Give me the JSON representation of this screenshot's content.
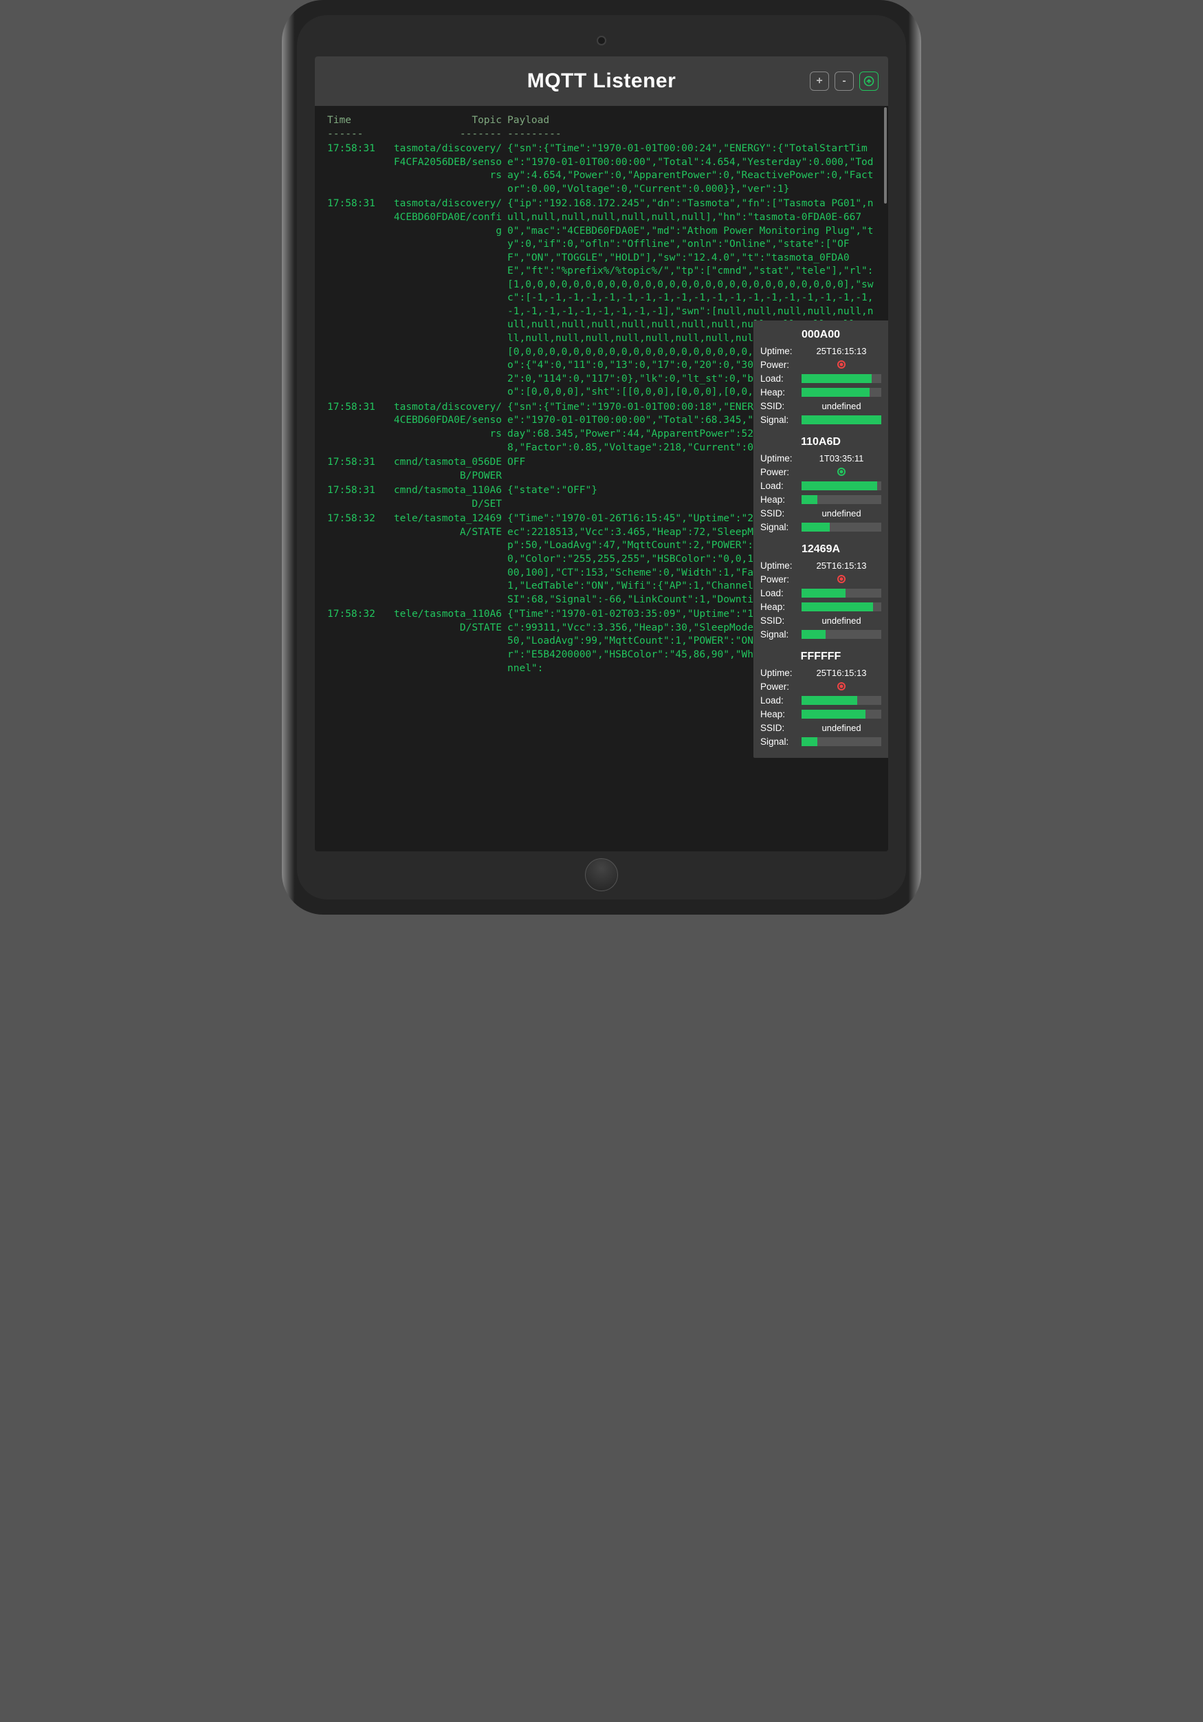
{
  "header": {
    "title": "MQTT Listener",
    "btn_plus": "+",
    "btn_minus": "-"
  },
  "columns": {
    "time": "Time",
    "topic": "Topic",
    "payload": "Payload"
  },
  "dashes": {
    "time": "------",
    "topic": "-------",
    "payload": "---------"
  },
  "rows": [
    {
      "time": "17:58:31",
      "topic": "tasmota/discovery/F4CFA2056DEB/sensors",
      "payload": "{\"sn\":{\"Time\":\"1970-01-01T00:00:24\",\"ENERGY\":{\"TotalStartTime\":\"1970-01-01T00:00:00\",\"Total\":4.654,\"Yesterday\":0.000,\"Today\":4.654,\"Power\":0,\"ApparentPower\":0,\"ReactivePower\":0,\"Factor\":0.00,\"Voltage\":0,\"Current\":0.000}},\"ver\":1}"
    },
    {
      "time": "17:58:31",
      "topic": "tasmota/discovery/4CEBD60FDA0E/config",
      "payload": "{\"ip\":\"192.168.172.245\",\"dn\":\"Tasmota\",\"fn\":[\"Tasmota PG01\",null,null,null,null,null,null,null],\"hn\":\"tasmota-0FDA0E-6670\",\"mac\":\"4CEBD60FDA0E\",\"md\":\"Athom Power Monitoring Plug\",\"ty\":0,\"if\":0,\"ofln\":\"Offline\",\"onln\":\"Online\",\"state\":[\"OFF\",\"ON\",\"TOGGLE\",\"HOLD\"],\"sw\":\"12.4.0\",\"t\":\"tasmota_0FDA0E\",\"ft\":\"%prefix%/%topic%/\",\"tp\":[\"cmnd\",\"stat\",\"tele\"],\"rl\":[1,0,0,0,0,0,0,0,0,0,0,0,0,0,0,0,0,0,0,0,0,0,0,0,0,0,0,0],\"swc\":[-1,-1,-1,-1,-1,-1,-1,-1,-1,-1,-1,-1,-1,-1,-1,-1,-1,-1,-1,-1,-1,-1,-1,-1,-1,-1,-1,-1],\"swn\":[null,null,null,null,null,null,null,null,null,null,null,null,null,null,null,null,null,null,null,null,null,null,null,null,null,null,null,null],\"btn\":[0,0,0,0,0,0,0,0,0,0,0,0,0,0,0,0,0,0,0,0,0,0,0,0,0,0,0,0],\"so\":{\"4\":0,\"11\":0,\"13\":0,\"17\":0,\"20\":0,\"30\":0,\"68\":0,\"73\":0,\"82\":0,\"114\":0,\"117\":0},\"lk\":0,\"lt_st\":0,\"bat\":0,\"dslp\":0,\"sho\":[0,0,0,0],\"sht\":[[0,0,0],[0,0,0],[0,0,0],[0,0,0]],\"ver\":1}"
    },
    {
      "time": "17:58:31",
      "topic": "tasmota/discovery/4CEBD60FDA0E/sensors",
      "payload": "{\"sn\":{\"Time\":\"1970-01-01T00:00:18\",\"ENERGY\":{\"TotalStartTime\":\"1970-01-01T00:00:00\",\"Total\":68.345,\"Yesterday\":0.000,\"Today\":68.345,\"Power\":44,\"ApparentPower\":52,\"ReactivePower\":28,\"Factor\":0.85,\"Voltage\":218,\"Current\":0.238}},\"ver\":1}"
    },
    {
      "time": "17:58:31",
      "topic": "cmnd/tasmota_056DEB/POWER",
      "payload": "OFF"
    },
    {
      "time": "17:58:31",
      "topic": "cmnd/tasmota_110A6D/SET",
      "payload": "{\"state\":\"OFF\"}"
    },
    {
      "time": "17:58:32",
      "topic": "tele/tasmota_12469A/STATE",
      "payload": "{\"Time\":\"1970-01-26T16:15:45\",\"Uptime\":\"25T16:15:13\",\"UptimeSec\":2218513,\"Vcc\":3.465,\"Heap\":72,\"SleepMode\":\"Dynamic\",\"Sleep\":50,\"LoadAvg\":47,\"MqttCount\":2,\"POWER\":\"OFF\",\"Dimmer\":100,\"Color\":\"255,255,255\",\"HSBColor\":\"0,0,100\",\"Channel\":[100,100,100],\"CT\":153,\"Scheme\":0,\"Width\":1,\"Fade\":\"OFF\",\"Speed\":1,\"LedTable\":\"ON\",\"Wifi\":{\"AP\":1,\"Channel\":6,\"Mode\":\"11n\",\"RSSI\":68,\"Signal\":-66,\"LinkCount\":1,\"Downtime\":\"0T00:00:04\"}}"
    },
    {
      "time": "17:58:32",
      "topic": "tele/tasmota_110A6D/STATE",
      "payload": "{\"Time\":\"1970-01-02T03:35:09\",\"Uptime\":\"1T03:35:11\",\"UptimeSec\":99311,\"Vcc\":3.356,\"Heap\":30,\"SleepMode\":\"Dynamic\",\"Sleep\":50,\"LoadAvg\":99,\"MqttCount\":1,\"POWER\":\"ON\",\"Dimmer\":90,\"Color\":\"E5B4200000\",\"HSBColor\":\"45,86,90\",\"White\":0,\"CT\":153,\"Channel\":"
    }
  ],
  "devices": [
    {
      "id": "000A00",
      "uptime": "25T16:15:13",
      "power": "off",
      "load": 88,
      "heap": 85,
      "ssid": "undefined",
      "signal": 100
    },
    {
      "id": "110A6D",
      "uptime": "1T03:35:11",
      "power": "on",
      "load": 95,
      "heap": 20,
      "ssid": "undefined",
      "signal": 35
    },
    {
      "id": "12469A",
      "uptime": "25T16:15:13",
      "power": "off",
      "load": 55,
      "heap": 90,
      "ssid": "undefined",
      "signal": 30
    },
    {
      "id": "FFFFFF",
      "uptime": "25T16:15:13",
      "power": "off",
      "load": 70,
      "heap": 80,
      "ssid": "undefined",
      "signal": 20
    }
  ],
  "labels": {
    "uptime": "Uptime:",
    "power": "Power:",
    "load": "Load:",
    "heap": "Heap:",
    "ssid": "SSID:",
    "signal": "Signal:"
  }
}
